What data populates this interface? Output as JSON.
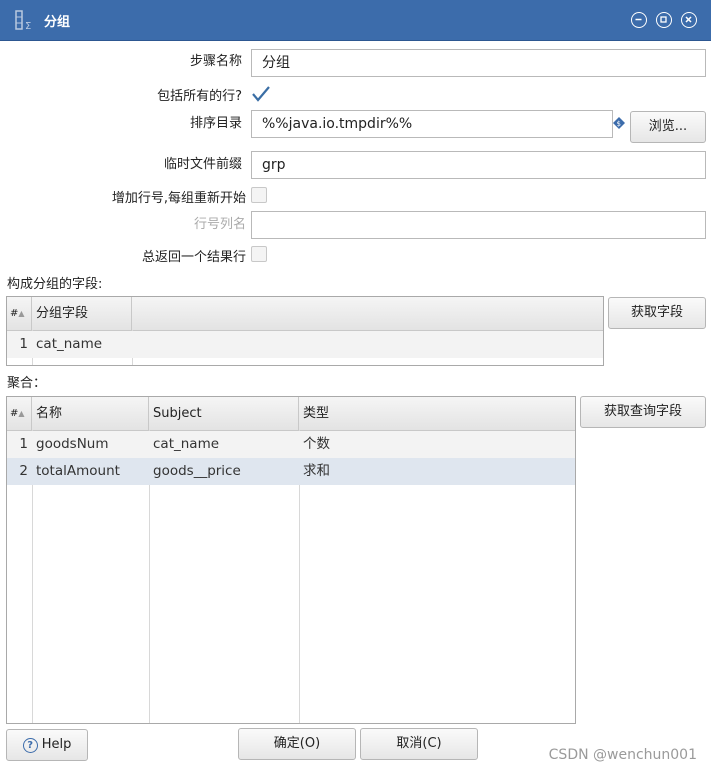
{
  "window": {
    "title": "分组",
    "title_icon": "grouping-icon",
    "controls": [
      "minimize-icon",
      "maximize-icon",
      "close-icon"
    ]
  },
  "form": {
    "step_name_label": "步骤名称",
    "step_name_value": "分组",
    "include_all_rows_label": "包括所有的行?",
    "include_all_rows_checked": true,
    "sort_dir_label": "排序目录",
    "sort_dir_value": "%%java.io.tmpdir%%",
    "browse_label": "浏览...",
    "temp_prefix_label": "临时文件前缀",
    "temp_prefix_value": "grp",
    "add_line_number_label": "增加行号,每组重新开始",
    "add_line_number_checked": false,
    "line_number_field_label": "行号列名",
    "line_number_field_value": "",
    "always_return_label": "总返回一个结果行",
    "always_return_checked": false
  },
  "group_fields": {
    "section_label": "构成分组的字段:",
    "get_fields_label": "获取字段",
    "columns": [
      "#",
      "分组字段"
    ],
    "rows": [
      {
        "num": "1",
        "field": "cat_name"
      }
    ]
  },
  "aggregates": {
    "section_label": "聚合：",
    "get_lookup_fields_label": "获取查询字段",
    "columns": [
      "#",
      "名称",
      "Subject",
      "类型"
    ],
    "rows": [
      {
        "num": "1",
        "name": "goodsNum",
        "subject": "cat_name",
        "type": "个数"
      },
      {
        "num": "2",
        "name": "totalAmount",
        "subject": "goods__price",
        "type": "求和"
      }
    ]
  },
  "footer": {
    "help_label": "Help",
    "ok_label": "确定(O)",
    "cancel_label": "取消(C)",
    "watermark": "CSDN @wenchun001"
  },
  "colors": {
    "titlebar": "#3c6cab",
    "selected_row": "#dfe6ef",
    "check_mark": "#3a6ea5"
  }
}
